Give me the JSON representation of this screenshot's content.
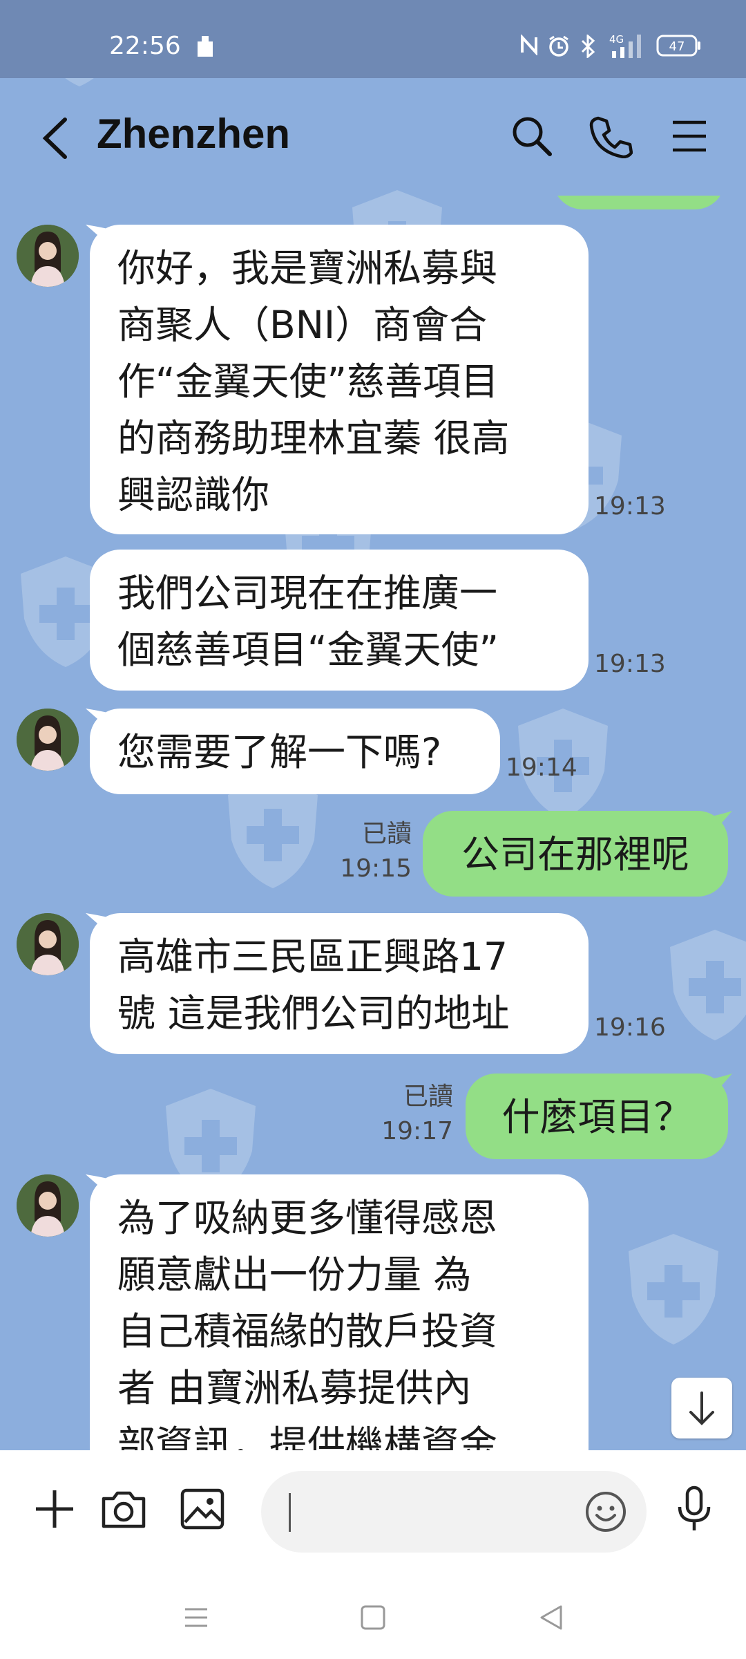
{
  "status_bar": {
    "time": "22:56",
    "battery": "47",
    "network": "4G"
  },
  "header": {
    "title": "Zhenzhen"
  },
  "messages": [
    {
      "direction": "in",
      "text": "你好，我是寶洲私募與\n商聚人（BNI）商會合\n作“金翼天使”慈善項目\n的商務助理林宜蓁  很高\n興認識你",
      "time": "19:13"
    },
    {
      "direction": "in",
      "text": "我們公司現在在推廣一\n個慈善項目“金翼天使”",
      "time": "19:13"
    },
    {
      "direction": "in",
      "text": "您需要了解一下嗎?",
      "time": "19:14"
    },
    {
      "direction": "out",
      "text": "公司在那裡呢",
      "read": "已讀",
      "time": "19:15"
    },
    {
      "direction": "in",
      "text": "高雄市三民區正興路17\n號 這是我們公司的地址",
      "time": "19:16"
    },
    {
      "direction": "out",
      "text": "什麼項目？",
      "read": "已讀",
      "time": "19:17"
    },
    {
      "direction": "in",
      "text": "為了吸納更多懂得感恩\n願意獻出一份力量 為\n自己積福緣的散戶投資\n者 由寶洲私募提供內\n部資訊，提供機構資金",
      "time": ""
    }
  ]
}
